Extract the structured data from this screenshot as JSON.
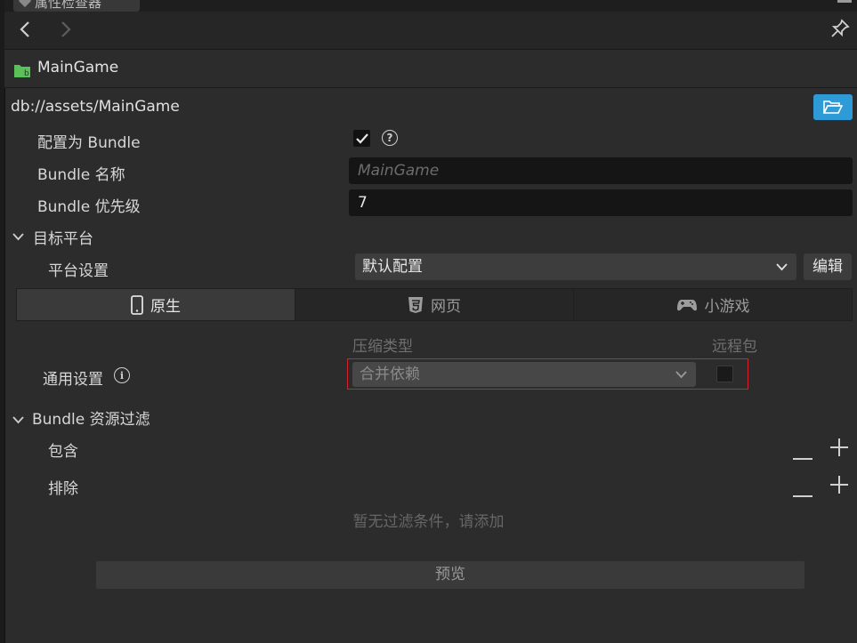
{
  "window": {
    "tab_title": "属性检查器"
  },
  "asset": {
    "name": "MainGame",
    "path": "db://assets/MainGame"
  },
  "bundle": {
    "config_label": "配置为 Bundle",
    "config_checked": true,
    "name_label": "Bundle 名称",
    "name_placeholder": "MainGame",
    "priority_label": "Bundle 优先级",
    "priority_value": "7"
  },
  "target": {
    "section_label": "目标平台",
    "platform_settings_label": "平台设置",
    "platform_settings_value": "默认配置",
    "edit_label": "编辑",
    "tabs": [
      {
        "label": "原生",
        "icon": "mobile-icon",
        "active": true
      },
      {
        "label": "网页",
        "icon": "html5-icon",
        "active": false
      },
      {
        "label": "小游戏",
        "icon": "gamepad-icon",
        "active": false
      }
    ],
    "compress_header": "压缩类型",
    "remote_header": "远程包",
    "general_label": "通用设置",
    "compress_value": "合并依赖",
    "remote_checked": false
  },
  "filter": {
    "section_label": "Bundle 资源过滤",
    "include_label": "包含",
    "exclude_label": "排除",
    "empty_text": "暂无过滤条件，请添加",
    "preview_label": "预览"
  },
  "colors": {
    "accent": "#2f9bd6",
    "highlight_border": "#d2232a",
    "folder": "#5ac05a"
  }
}
